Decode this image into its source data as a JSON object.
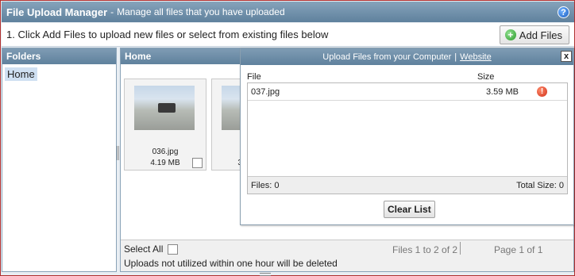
{
  "window": {
    "title": "File Upload Manager",
    "separator": "-",
    "subtitle": "Manage all files that you have uploaded",
    "help_icon": "?"
  },
  "instructions": {
    "text": "1. Click Add Files to upload new files or select from existing files below",
    "add_button_label": "Add Files",
    "add_icon": "+"
  },
  "folders": {
    "header": "Folders",
    "items": [
      {
        "label": "Home",
        "selected": true
      }
    ]
  },
  "main": {
    "header": "Home",
    "files": [
      {
        "name": "036.jpg",
        "size": "4.19 MB"
      },
      {
        "name": "037.jpg",
        "size": "3.59 MB"
      }
    ],
    "footer": {
      "select_all": "Select All",
      "files_count": "Files 1 to 2 of 2",
      "page_info": "Page 1 of 1",
      "notice": "Uploads not utilized within one hour will be deleted"
    }
  },
  "upload_dialog": {
    "title": "Upload Files from your Computer",
    "title_sep": "|",
    "link": "Website",
    "close": "x",
    "columns": {
      "file": "File",
      "size": "Size"
    },
    "rows": [
      {
        "file": "037.jpg",
        "size": "3.59 MB",
        "status_icon": "!"
      }
    ],
    "footer_left": "Files: 0",
    "footer_right": "Total Size: 0",
    "clear_button": "Clear List"
  },
  "colors": {
    "header_gradient_top": "#86a3bb",
    "header_gradient_bottom": "#5f819d",
    "selection": "#cfe0f2",
    "frame_border": "#b03030"
  }
}
